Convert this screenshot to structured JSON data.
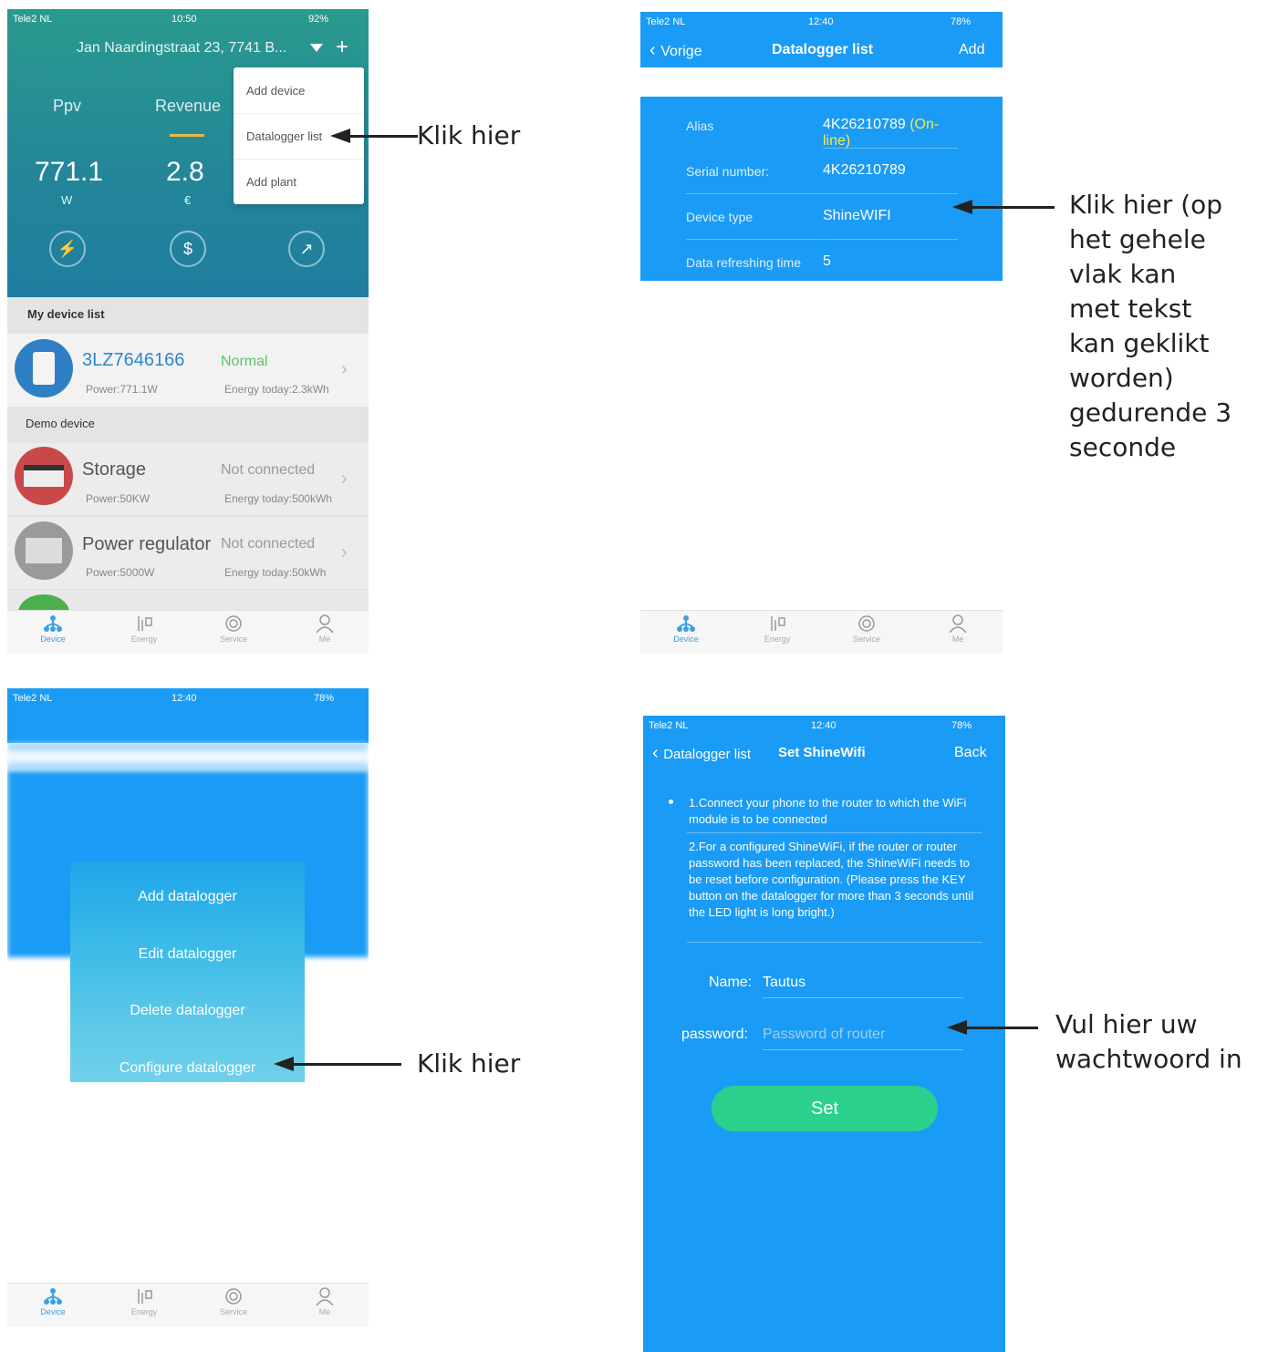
{
  "p1": {
    "status": {
      "carrier": "Tele2 NL",
      "time": "10:50",
      "battery": "92%"
    },
    "address": "Jan Naardingstraat 23, 7741 B...",
    "stats": [
      {
        "label": "Ppv",
        "value": "771.1",
        "unit": "W"
      },
      {
        "label": "Revenue",
        "value": "2.8",
        "unit": "€"
      }
    ],
    "menu": [
      "Add device",
      "Datalogger list",
      "Add plant"
    ],
    "my_device_header": "My device list",
    "demo_header": "Demo device",
    "devices": [
      {
        "name": "3LZ7646166",
        "status": "Normal",
        "power": "Power:771.1W",
        "energy": "Energy today:2.3kWh"
      },
      {
        "name": "Storage",
        "status": "Not connected",
        "power": "Power:50KW",
        "energy": "Energy today:500kWh"
      },
      {
        "name": "Power regulator",
        "status": "Not connected",
        "power": "Power:5000W",
        "energy": "Energy today:50kWh"
      }
    ]
  },
  "tabs": [
    "Device",
    "Energy",
    "Service",
    "Me"
  ],
  "p2": {
    "status": {
      "carrier": "Tele2 NL",
      "time": "12:40",
      "battery": "78%"
    },
    "back": "Vorige",
    "title": "Datalogger list",
    "add": "Add",
    "rows": [
      {
        "key": "Alias",
        "value": "4K26210789",
        "extra": "(On-line)"
      },
      {
        "key": "Serial number:",
        "value": "4K26210789"
      },
      {
        "key": "Device type",
        "value": "ShineWIFI"
      },
      {
        "key": "Data refreshing time",
        "value": "5"
      }
    ]
  },
  "p3": {
    "status": {
      "carrier": "Tele2 NL",
      "time": "12:40",
      "battery": "78%"
    },
    "actions": [
      "Add datalogger",
      "Edit datalogger",
      "Delete datalogger",
      "Configure datalogger"
    ]
  },
  "p4": {
    "status": {
      "carrier": "Tele2 NL",
      "time": "12:40",
      "battery": "78%"
    },
    "back": "Datalogger list",
    "title": "Set ShineWifi",
    "right": "Back",
    "instr1": "1.Connect your phone to the router to which the WiFi module is to be connected",
    "instr2": "2.For a configured ShineWiFi, if the router or router password has been replaced, the ShineWiFi needs to be reset before configuration. (Please press the KEY button on the datalogger for more than 3 seconds until the LED light is long bright.)",
    "name_label": "Name:",
    "name_value": "Tautus",
    "pwd_label": "password:",
    "pwd_placeholder": "Password of router",
    "set": "Set"
  },
  "notes": {
    "n1": "Klik hier",
    "n2": [
      "Klik hier (op",
      "het gehele",
      "vlak kan",
      "met tekst",
      "kan geklikt",
      "worden)",
      "gedurende 3",
      "seconde"
    ],
    "n3": "Klik hier",
    "n4": [
      "Vul hier uw",
      "wachtwoord in"
    ]
  },
  "colors": {
    "blue": "#1a9bf5",
    "teal": "#1f8f99",
    "green": "#2ad08c"
  }
}
